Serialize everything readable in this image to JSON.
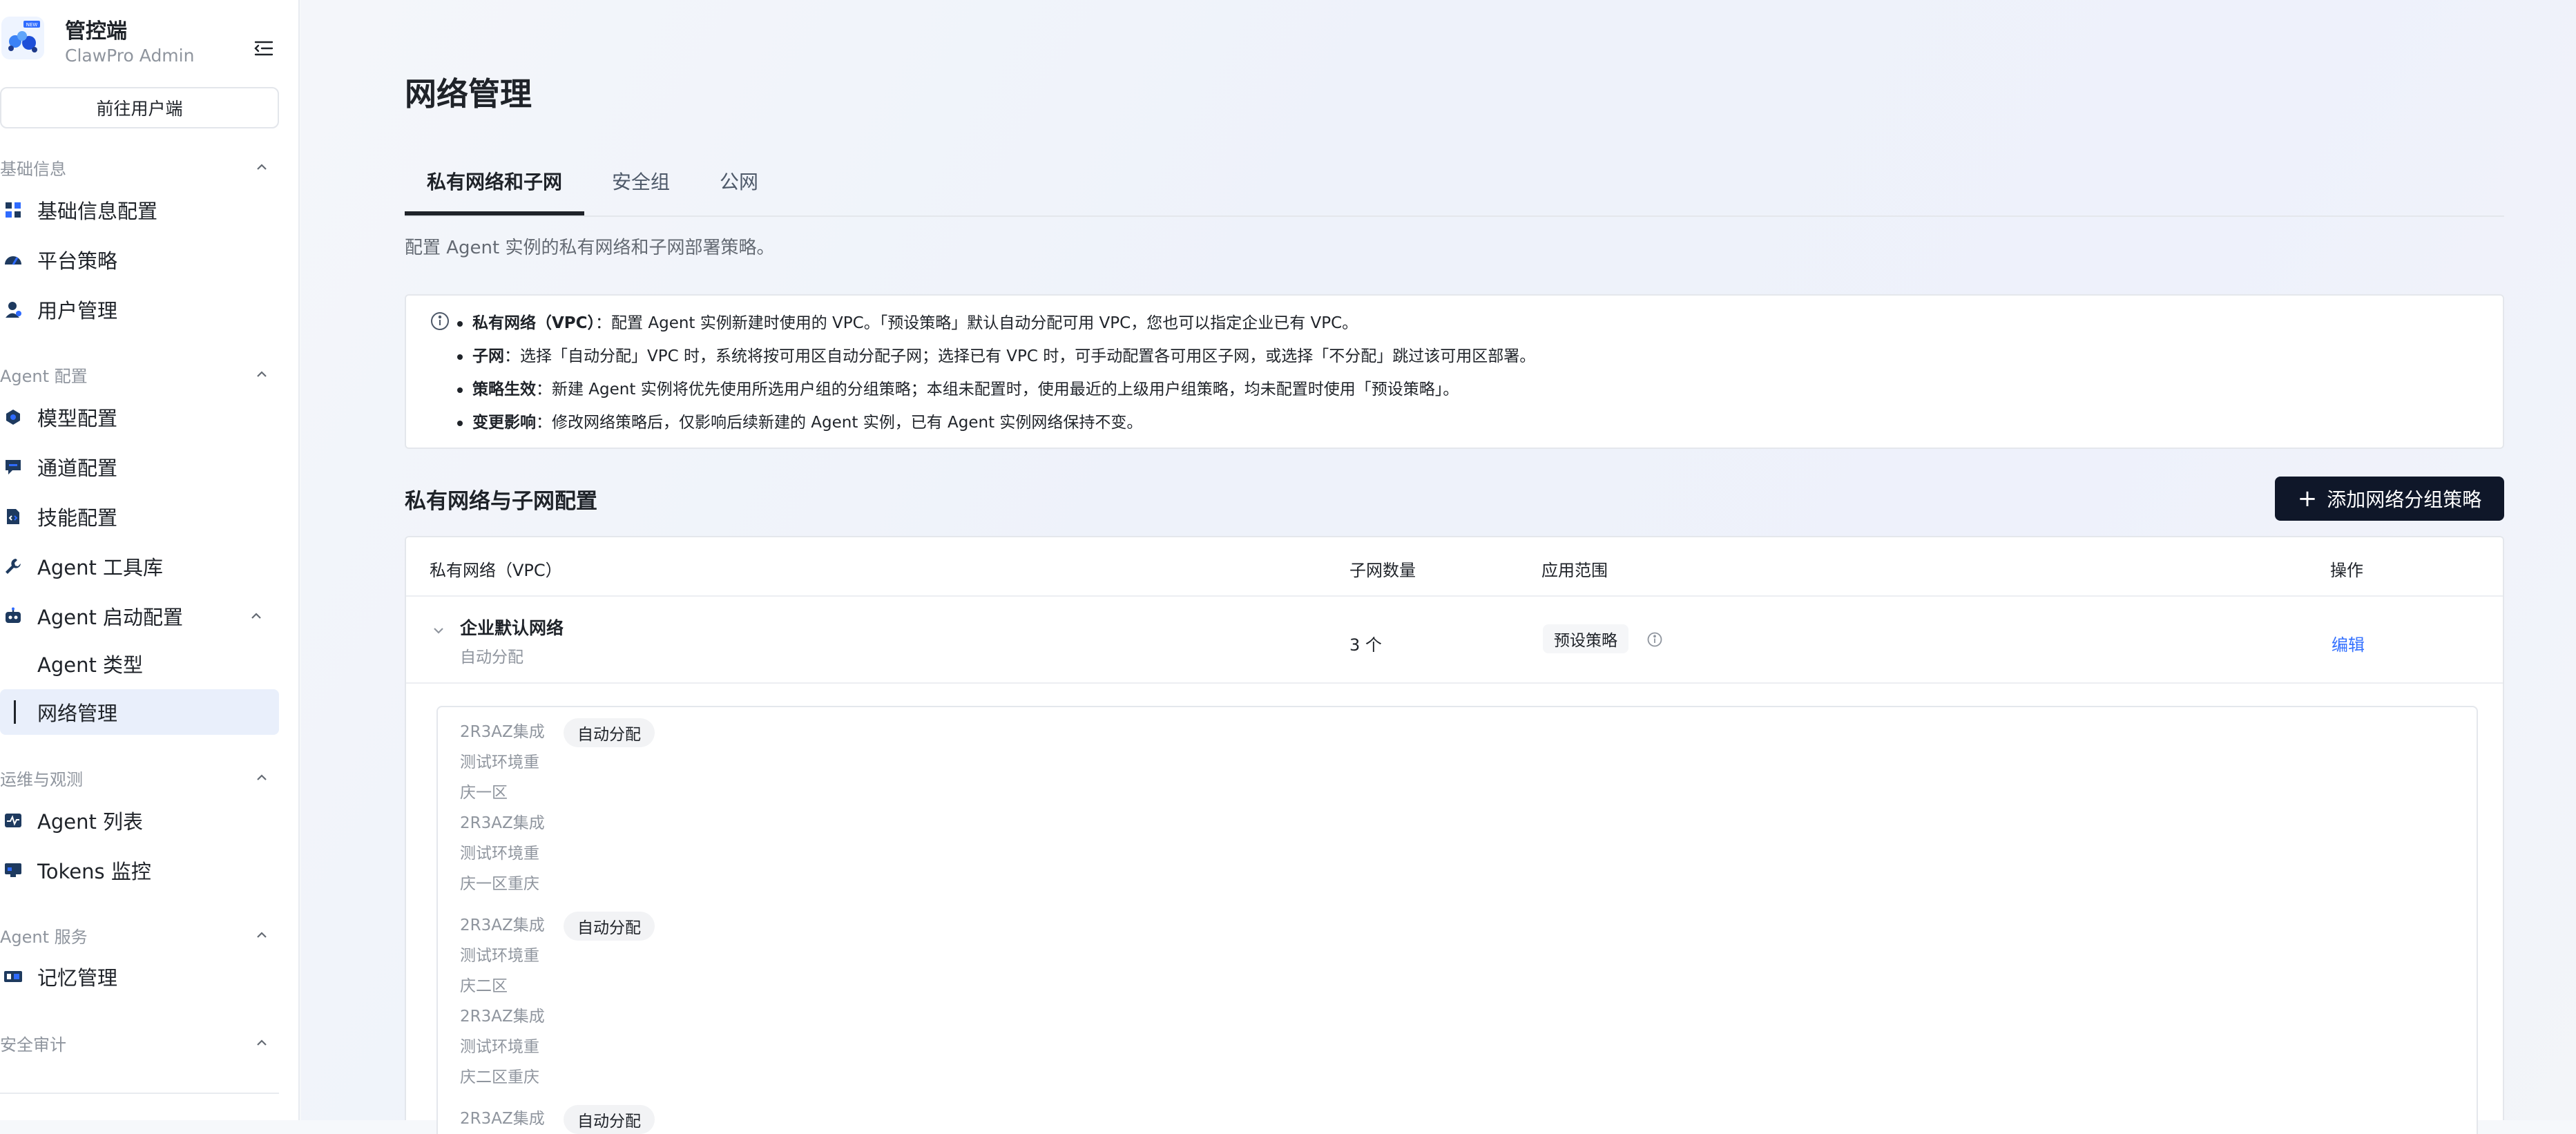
{
  "brand": {
    "title": "管控端",
    "subtitle": "ClawPro Admin",
    "logo_badge": "NEW"
  },
  "sidebar": {
    "goto_user": "前往用户端",
    "groups": [
      {
        "label": "基础信息",
        "items": [
          "基础信息配置",
          "平台策略",
          "用户管理"
        ]
      },
      {
        "label": "Agent 配置",
        "items": [
          "模型配置",
          "通道配置",
          "技能配置",
          "Agent 工具库",
          "Agent 启动配置"
        ],
        "subitems": [
          "Agent 类型",
          "网络管理"
        ]
      },
      {
        "label": "运维与观测",
        "items": [
          "Agent 列表",
          "Tokens 监控"
        ]
      },
      {
        "label": "Agent 服务",
        "items": [
          "记忆管理"
        ]
      },
      {
        "label": "安全审计",
        "items": []
      }
    ]
  },
  "main": {
    "title": "网络管理",
    "tabs": [
      "私有网络和子网",
      "安全组",
      "公网"
    ],
    "description": "配置 Agent 实例的私有网络和子网部署策略。",
    "info": [
      {
        "label": "私有网络（VPC）",
        "text": "：配置 Agent 实例新建时使用的 VPC。「预设策略」默认自动分配可用 VPC，您也可以指定企业已有 VPC。"
      },
      {
        "label": "子网",
        "text": "：选择「自动分配」VPC 时，系统将按可用区自动分配子网；选择已有 VPC 时，可手动配置各可用区子网，或选择「不分配」跳过该可用区部署。"
      },
      {
        "label": "策略生效",
        "text": "：新建 Agent 实例将优先使用所选用户组的分组策略；本组未配置时，使用最近的上级用户组策略，均未配置时使用「预设策略」。"
      },
      {
        "label": "变更影响",
        "text": "：修改网络策略后，仅影响后续新建的 Agent 实例，已有 Agent 实例网络保持不变。"
      }
    ],
    "section_title": "私有网络与子网配置",
    "add_button": "添加网络分组策略",
    "table": {
      "headers": [
        "私有网络（VPC）",
        "子网数量",
        "应用范围",
        "操作"
      ],
      "row": {
        "name": "企业默认网络",
        "sub": "自动分配",
        "count": "3 个",
        "scope": "预设策略",
        "action": "编辑"
      },
      "subnets": [
        {
          "lines": [
            "2R3AZ集成",
            "测试环境重",
            "庆一区",
            "2R3AZ集成",
            "测试环境重",
            "庆一区重庆"
          ],
          "badge": "自动分配"
        },
        {
          "lines": [
            "2R3AZ集成",
            "测试环境重",
            "庆二区",
            "2R3AZ集成",
            "测试环境重",
            "庆二区重庆"
          ],
          "badge": "自动分配"
        },
        {
          "lines": [
            "2R3AZ集成"
          ],
          "badge": "自动分配"
        }
      ]
    }
  }
}
